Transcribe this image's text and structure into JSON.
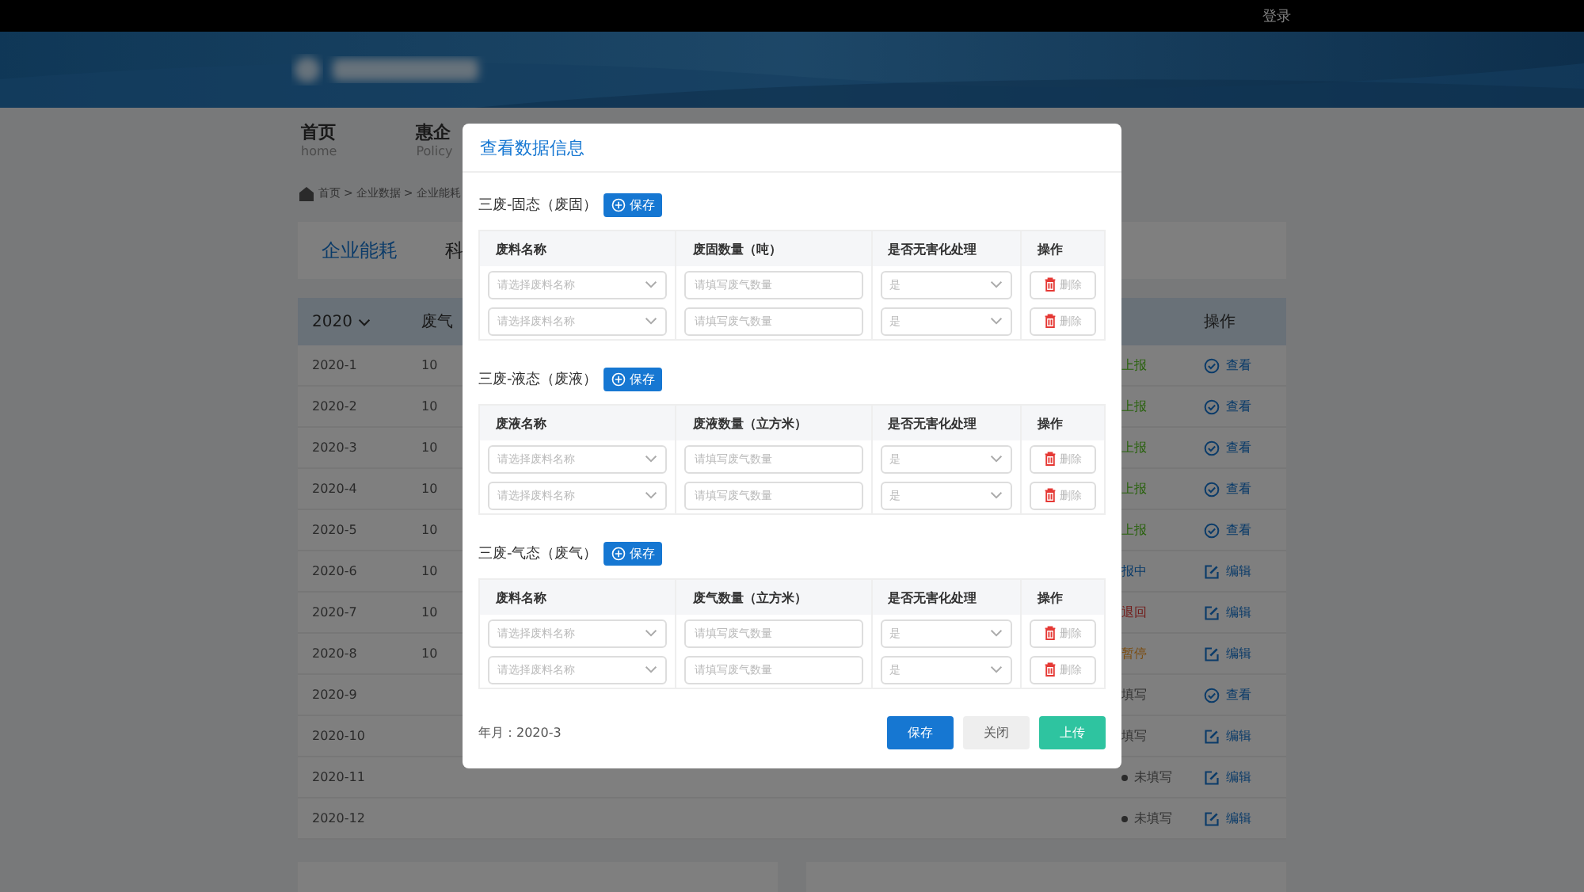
{
  "top_bar": {
    "login": "登录"
  },
  "nav": [
    {
      "label": "首页",
      "sub": "home"
    },
    {
      "label": "惠企",
      "sub": "Policy"
    }
  ],
  "breadcrumb": [
    "首页",
    ">",
    "企业数据",
    ">",
    "企业能耗"
  ],
  "tabs": [
    {
      "label": "企业能耗",
      "selected": true
    },
    {
      "label": "科",
      "selected": false
    }
  ],
  "table": {
    "year": "2020",
    "columns": [
      "废气",
      "操作"
    ],
    "rows": [
      {
        "month": "2020-1",
        "value": "10",
        "status": {
          "text": "上报",
          "kind": "done",
          "dot": false
        },
        "action": {
          "kind": "view",
          "label": "查看"
        }
      },
      {
        "month": "2020-2",
        "value": "10",
        "status": {
          "text": "上报",
          "kind": "done",
          "dot": false
        },
        "action": {
          "kind": "view",
          "label": "查看"
        }
      },
      {
        "month": "2020-3",
        "value": "10",
        "status": {
          "text": "上报",
          "kind": "done",
          "dot": false
        },
        "action": {
          "kind": "view",
          "label": "查看"
        }
      },
      {
        "month": "2020-4",
        "value": "10",
        "status": {
          "text": "上报",
          "kind": "done",
          "dot": false
        },
        "action": {
          "kind": "view",
          "label": "查看"
        }
      },
      {
        "month": "2020-5",
        "value": "10",
        "status": {
          "text": "上报",
          "kind": "done",
          "dot": false
        },
        "action": {
          "kind": "view",
          "label": "查看"
        }
      },
      {
        "month": "2020-6",
        "value": "10",
        "status": {
          "text": "报中",
          "kind": "pending",
          "dot": false
        },
        "action": {
          "kind": "edit",
          "label": "编辑"
        }
      },
      {
        "month": "2020-7",
        "value": "10",
        "status": {
          "text": "退回",
          "kind": "returned",
          "dot": false
        },
        "action": {
          "kind": "edit",
          "label": "编辑"
        }
      },
      {
        "month": "2020-8",
        "value": "10",
        "status": {
          "text": "暂停",
          "kind": "paused",
          "dot": false
        },
        "action": {
          "kind": "edit",
          "label": "编辑"
        }
      },
      {
        "month": "2020-9",
        "status": {
          "text": "填写",
          "kind": "empty",
          "dot": false
        },
        "action": {
          "kind": "view",
          "label": "查看"
        }
      },
      {
        "month": "2020-10",
        "status": {
          "text": "填写",
          "kind": "empty",
          "dot": false
        },
        "action": {
          "kind": "edit",
          "label": "编辑"
        }
      },
      {
        "month": "2020-11",
        "status": {
          "text": "未填写",
          "kind": "empty",
          "dot": true
        },
        "action": {
          "kind": "edit",
          "label": "编辑"
        }
      },
      {
        "month": "2020-12",
        "status": {
          "text": "未填写",
          "kind": "empty",
          "dot": true
        },
        "action": {
          "kind": "edit",
          "label": "编辑"
        }
      }
    ]
  },
  "dialog": {
    "title": "查看数据信息",
    "sections": [
      {
        "title": "三废-固态（废固）",
        "button": "保存",
        "columns": [
          "废料名称",
          "废固数量（吨）",
          "是否无害化处理",
          "操作"
        ],
        "rows": [
          {
            "name": {
              "placeholder": "请选择废料名称"
            },
            "amount": {
              "placeholder": "请填写废气数量"
            },
            "harmless": {
              "placeholder": "是"
            },
            "delete": "删除"
          },
          {
            "name": {
              "placeholder": "请选择废料名称"
            },
            "amount": {
              "placeholder": "请填写废气数量"
            },
            "harmless": {
              "placeholder": "是"
            },
            "delete": "删除"
          }
        ]
      },
      {
        "title": "三废-液态（废液）",
        "button": "保存",
        "columns": [
          "废液名称",
          "废液数量（立方米）",
          "是否无害化处理",
          "操作"
        ],
        "rows": [
          {
            "name": {
              "placeholder": "请选择废料名称"
            },
            "amount": {
              "placeholder": "请填写废气数量"
            },
            "harmless": {
              "placeholder": "是"
            },
            "delete": "删除"
          },
          {
            "name": {
              "placeholder": "请选择废料名称"
            },
            "amount": {
              "placeholder": "请填写废气数量"
            },
            "harmless": {
              "placeholder": "是"
            },
            "delete": "删除"
          }
        ]
      },
      {
        "title": "三废-气态（废气）",
        "button": "保存",
        "columns": [
          "废料名称",
          "废气数量（立方米）",
          "是否无害化处理",
          "操作"
        ],
        "rows": [
          {
            "name": {
              "placeholder": "请选择废料名称"
            },
            "amount": {
              "placeholder": "请填写废气数量"
            },
            "harmless": {
              "placeholder": "是"
            },
            "delete": "删除"
          },
          {
            "name": {
              "placeholder": "请选择废料名称"
            },
            "amount": {
              "placeholder": "请填写废气数量"
            },
            "harmless": {
              "placeholder": "是"
            },
            "delete": "删除"
          }
        ]
      }
    ],
    "period": "年月：2020-3",
    "buttons": [
      {
        "label": "保存",
        "kind": "primary"
      },
      {
        "label": "关闭",
        "kind": "default"
      },
      {
        "label": "上传",
        "kind": "success"
      }
    ]
  }
}
